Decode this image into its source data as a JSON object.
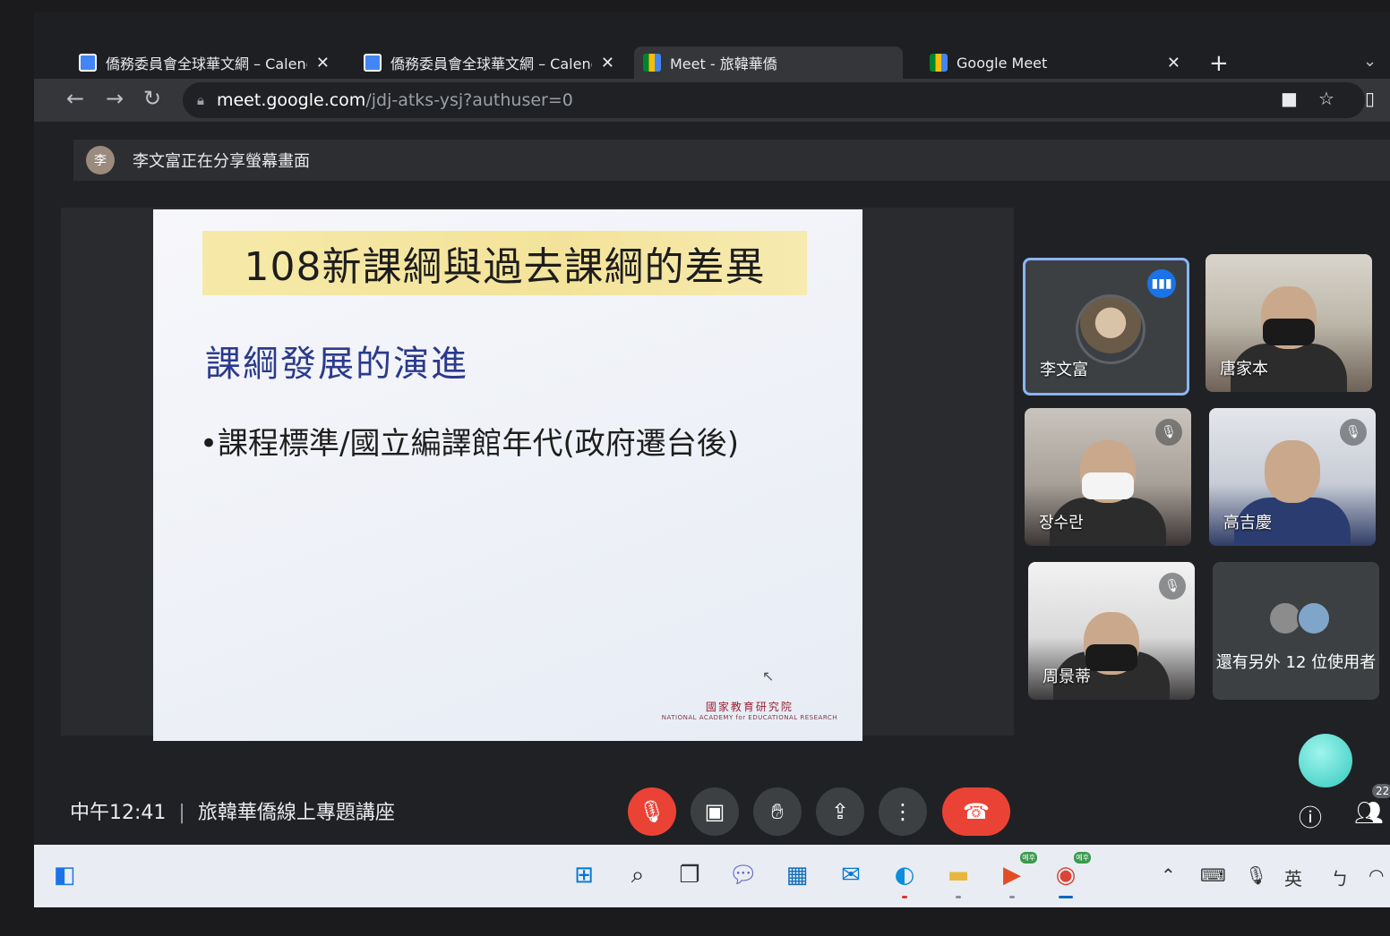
{
  "tabs": [
    {
      "title": "僑務委員會全球華文網 – Calend",
      "icon": "calendar-icon"
    },
    {
      "title": "僑務委員會全球華文網 – Calend",
      "icon": "calendar-icon"
    },
    {
      "title": "Meet - 旅韓華僑",
      "icon": "meet-icon"
    },
    {
      "title": "Google Meet",
      "icon": "meet-icon"
    }
  ],
  "browser": {
    "url_host": "meet.google.com",
    "url_path": "/jdj-atks-ysj?authuser=0"
  },
  "meet": {
    "share_banner": "李文富正在分享螢幕畫面",
    "slide": {
      "title": "108新課綱與過去課綱的差異",
      "heading": "課綱發展的演進",
      "bullet": "•課程標準/國立編譯館年代(政府遷台後)",
      "logo_cn": "國家教育研究院",
      "logo_en": "NATIONAL ACADEMY for EDUCATIONAL RESEARCH"
    },
    "participants": [
      {
        "name": "李文富",
        "speaking": true
      },
      {
        "name": "唐家本"
      },
      {
        "name": "장수란",
        "muted": true
      },
      {
        "name": "高吉慶",
        "muted": true
      },
      {
        "name": "周景蒂",
        "muted": true
      }
    ],
    "others_label": "還有另外 12 位使用者",
    "time": "中午12:41",
    "meeting_title": "旅韓華僑線上專題講座",
    "participant_count": "22"
  },
  "taskbar": {
    "ime_label": "英",
    "badge_meet": "예후",
    "badge_chrome": "예후"
  },
  "colors": {
    "accent_blue": "#8ab4f8",
    "hangup_red": "#ea4335",
    "slide_heading": "#2b3a8c"
  }
}
